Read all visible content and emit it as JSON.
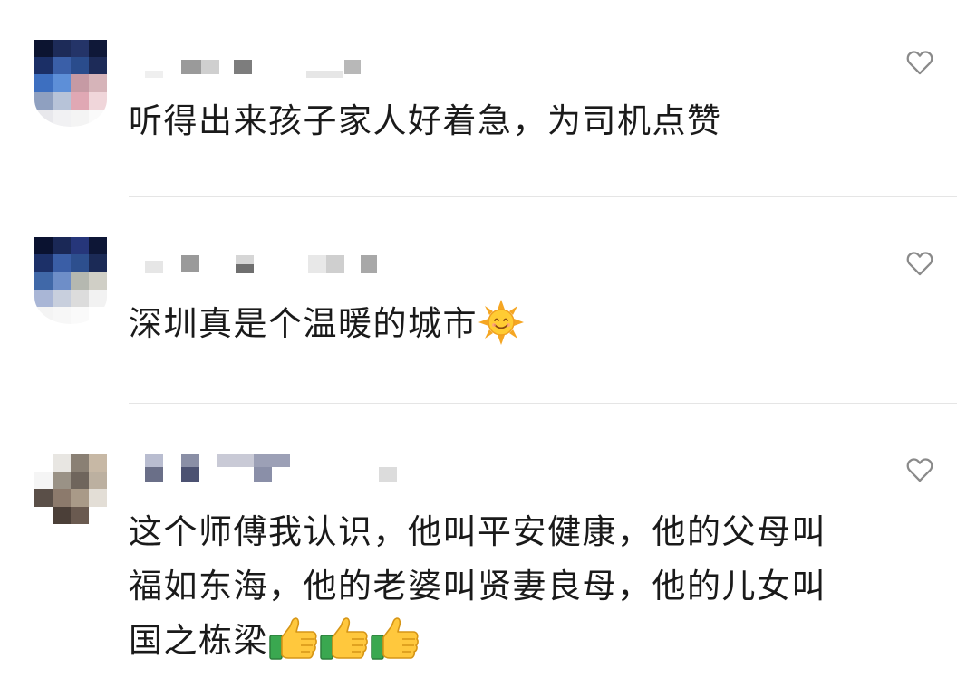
{
  "comments": [
    {
      "text": "听得出来孩子家人好着急，为司机点赞",
      "emoji": []
    },
    {
      "text": "深圳真是个温暖的城市",
      "emoji": [
        "sun-face-emoji"
      ]
    },
    {
      "lines": [
        "这个师傅我认识，他叫平安健康，他的父母叫",
        "福如东海，他的老婆叫贤妻良母，他的儿女叫",
        "国之栋梁"
      ],
      "emoji": [
        "thumbs-up-emoji",
        "thumbs-up-emoji",
        "thumbs-up-emoji"
      ]
    }
  ],
  "icons": {
    "like": "heart-outline-icon"
  },
  "colors": {
    "text": "#1a1a1a",
    "divider": "#e5e5e5",
    "heart": "#8a8a8a"
  }
}
